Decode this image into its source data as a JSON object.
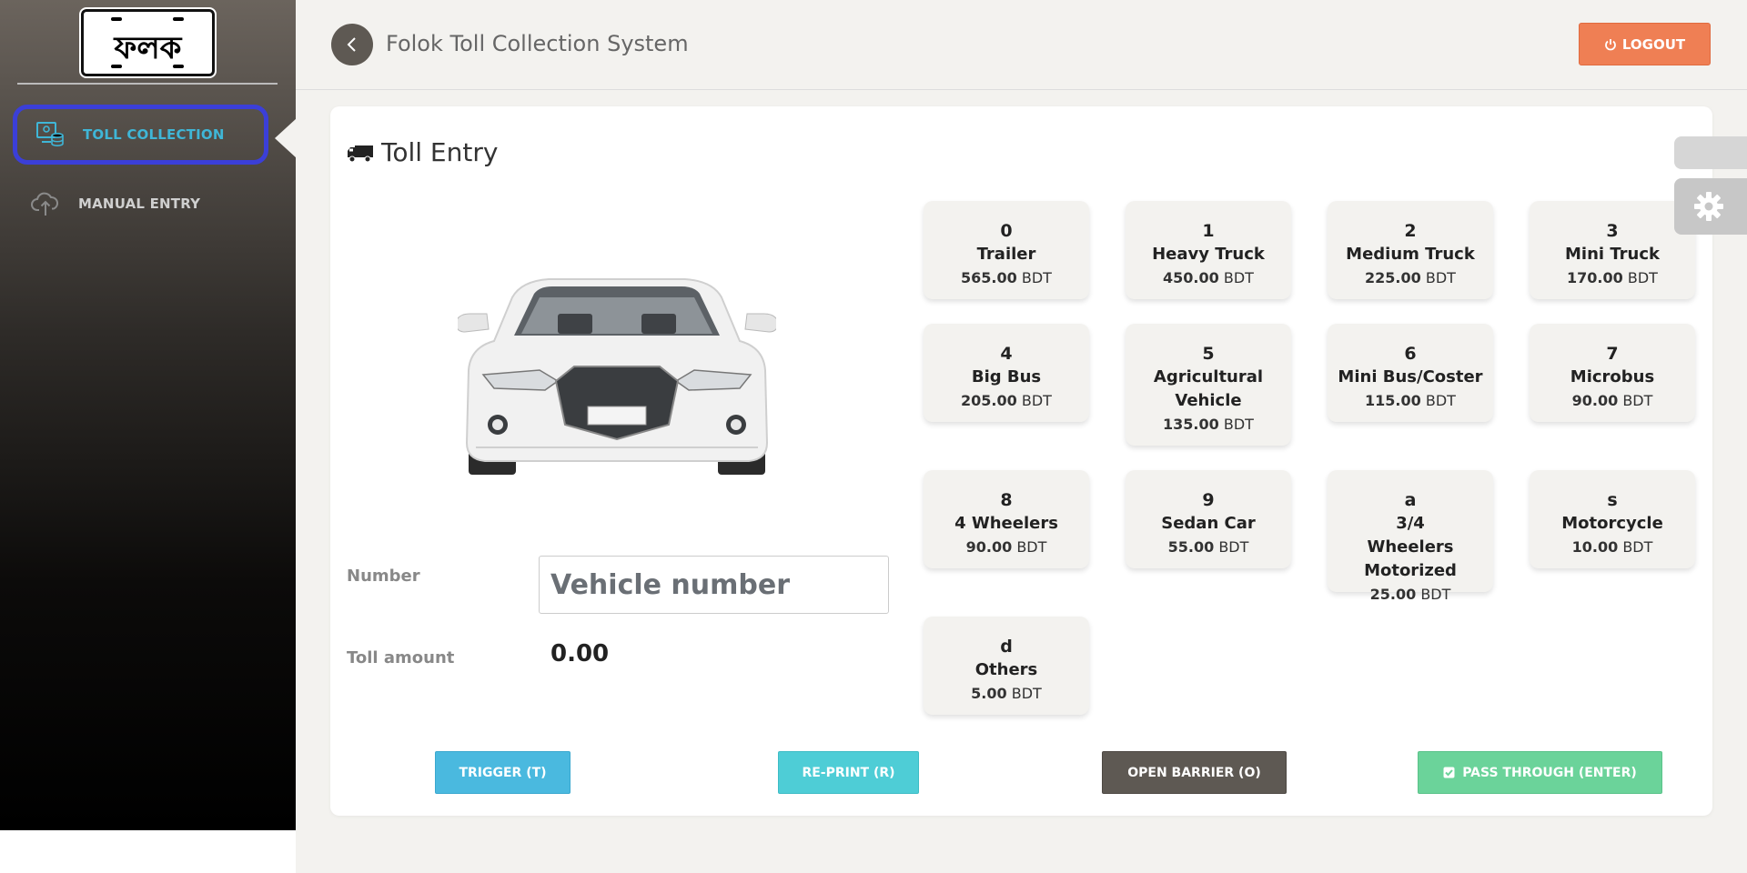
{
  "sidebar": {
    "logo_text": "ফলক",
    "items": [
      {
        "label": "TOLL COLLECTION",
        "icon": "toll-collection-icon"
      },
      {
        "label": "MANUAL ENTRY",
        "icon": "cloud-upload-icon"
      }
    ]
  },
  "header": {
    "title": "Folok Toll Collection System",
    "logout_label": "LOGOUT"
  },
  "main": {
    "title": "Toll Entry",
    "number_label": "Number",
    "number_placeholder": "Vehicle number",
    "toll_amount_label": "Toll amount",
    "toll_amount_value": "0.00",
    "currency": "BDT"
  },
  "vehicles": [
    {
      "key": "0",
      "name": "Trailer",
      "price": "565.00"
    },
    {
      "key": "1",
      "name": "Heavy Truck",
      "price": "450.00"
    },
    {
      "key": "2",
      "name": "Medium Truck",
      "price": "225.00"
    },
    {
      "key": "3",
      "name": "Mini Truck",
      "price": "170.00"
    },
    {
      "key": "4",
      "name": "Big Bus",
      "price": "205.00"
    },
    {
      "key": "5",
      "name": "Agricultural Vehicle",
      "price": "135.00"
    },
    {
      "key": "6",
      "name": "Mini Bus/Coster",
      "price": "115.00"
    },
    {
      "key": "7",
      "name": "Microbus",
      "price": "90.00"
    },
    {
      "key": "8",
      "name": "4 Wheelers",
      "price": "90.00"
    },
    {
      "key": "9",
      "name": "Sedan Car",
      "price": "55.00"
    },
    {
      "key": "a",
      "name": "3/4 Wheelers Motorized",
      "price": "25.00"
    },
    {
      "key": "s",
      "name": "Motorcycle",
      "price": "10.00"
    },
    {
      "key": "d",
      "name": "Others",
      "price": "5.00"
    }
  ],
  "actions": {
    "trigger": "TRIGGER (T)",
    "reprint": "RE-PRINT (R)",
    "open_barrier": "OPEN BARRIER (O)",
    "pass_through": "PASS THROUGH (ENTER)"
  },
  "colors": {
    "logout": "#ef7f54",
    "trigger": "#4ab9df",
    "reprint": "#4ecdd6",
    "open_barrier": "#5e5953",
    "pass_through": "#6bd39a",
    "active_nav": "#3fb6d7",
    "active_outline": "#3b3fd8"
  }
}
